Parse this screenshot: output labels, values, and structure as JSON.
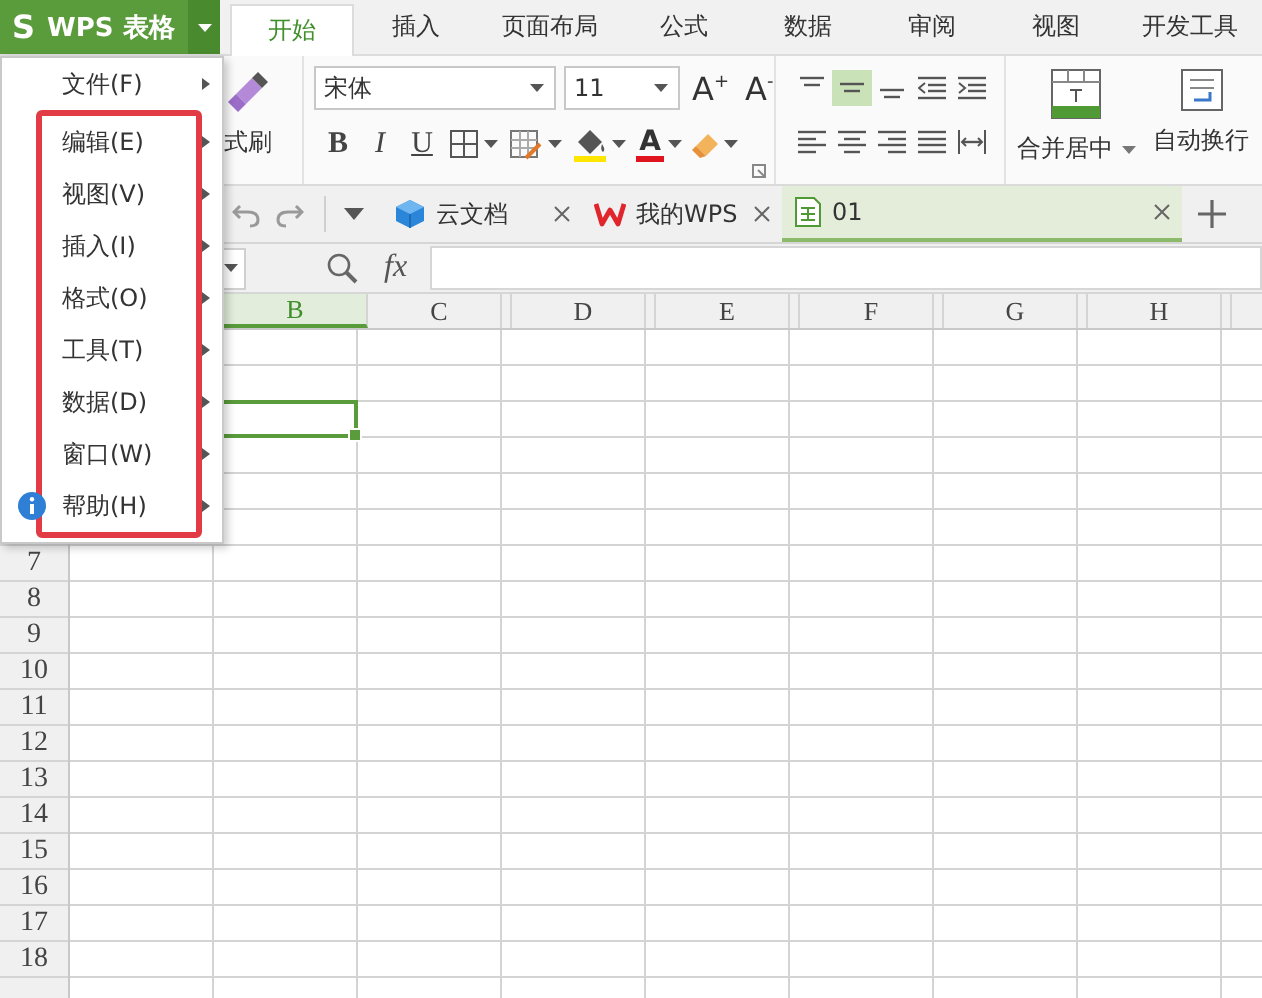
{
  "app_button": {
    "logo": "S",
    "label": "WPS 表格"
  },
  "ribbon_tabs": [
    {
      "label": "开始",
      "selected": true
    },
    {
      "label": "插入",
      "selected": false
    },
    {
      "label": "页面布局",
      "selected": false
    },
    {
      "label": "公式",
      "selected": false
    },
    {
      "label": "数据",
      "selected": false
    },
    {
      "label": "审阅",
      "selected": false
    },
    {
      "label": "视图",
      "selected": false
    },
    {
      "label": "开发工具",
      "selected": false
    }
  ],
  "ribbon": {
    "format_painter": "式刷",
    "font_name": "宋体",
    "font_size": "11",
    "size_buttons": [
      {
        "label": "A",
        "sign": "+"
      },
      {
        "label": "A",
        "sign": "-"
      }
    ],
    "style_buttons": [
      {
        "label": "B",
        "kind": "bold"
      },
      {
        "label": "I",
        "kind": "italic"
      },
      {
        "label": "U",
        "kind": "underline"
      }
    ],
    "font_color_label": "A",
    "align_buttons": [
      {
        "kind": "top",
        "selected": false
      },
      {
        "kind": "middle",
        "selected": true
      },
      {
        "kind": "bottom",
        "selected": false
      },
      {
        "kind": "outdent",
        "selected": false
      },
      {
        "kind": "indent",
        "selected": false
      },
      {
        "kind": "left",
        "selected": false
      },
      {
        "kind": "center",
        "selected": false
      },
      {
        "kind": "right",
        "selected": false
      },
      {
        "kind": "justify",
        "selected": false
      },
      {
        "kind": "distributed",
        "selected": false
      }
    ],
    "merge_label": "合并居中",
    "wrap_label": "自动换行"
  },
  "doc_tabs": [
    {
      "label": "云文档",
      "kind": "cloud",
      "selected": false
    },
    {
      "label": "我的WPS",
      "kind": "wps",
      "selected": false
    },
    {
      "label": "01",
      "kind": "sheet",
      "selected": true
    }
  ],
  "formula_bar": {
    "function_label": "fx"
  },
  "sheet": {
    "columns": [
      {
        "label": "B",
        "selected": true
      },
      {
        "label": "C",
        "selected": false
      },
      {
        "label": "D",
        "selected": false
      },
      {
        "label": "E",
        "selected": false
      },
      {
        "label": "F",
        "selected": false
      },
      {
        "label": "G",
        "selected": false
      },
      {
        "label": "H",
        "selected": false
      }
    ],
    "active_cell": {
      "selected": true
    },
    "rows": [
      "7",
      "8",
      "9",
      "10",
      "11",
      "12",
      "13",
      "14",
      "15",
      "16",
      "17",
      "18"
    ]
  },
  "menu": {
    "sections": [
      {
        "highlighted": false,
        "items": [
          {
            "label": "文件(F)",
            "kind": "plain"
          }
        ]
      },
      {
        "highlighted": true,
        "items": [
          {
            "label": "编辑(E)",
            "kind": "plain"
          },
          {
            "label": "视图(V)",
            "kind": "plain"
          },
          {
            "label": "插入(I)",
            "kind": "plain"
          },
          {
            "label": "格式(O)",
            "kind": "plain"
          },
          {
            "label": "工具(T)",
            "kind": "plain"
          },
          {
            "label": "数据(D)",
            "kind": "plain"
          },
          {
            "label": "窗口(W)",
            "kind": "plain"
          },
          {
            "label": "帮助(H)",
            "kind": "help"
          }
        ]
      }
    ]
  }
}
